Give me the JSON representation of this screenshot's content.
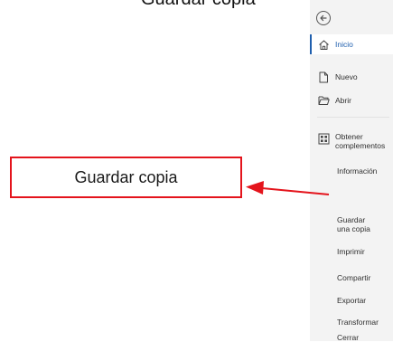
{
  "top_caption": "Guardar copia",
  "callout": {
    "label": "Guardar copia",
    "color": "#e4141c"
  },
  "backstage": {
    "back_icon": "back-arrow-circle-icon",
    "items": [
      {
        "label": "Inicio",
        "icon": "home-icon",
        "selected": true
      },
      {
        "label": "Nuevo",
        "icon": "new-document-icon"
      },
      {
        "label": "Abrir",
        "icon": "open-folder-icon"
      },
      {
        "label": "Obtener complementos",
        "icon": "addins-grid-icon"
      },
      {
        "label": "Información"
      },
      {
        "label": "Guardar una copia"
      },
      {
        "label": "Imprimir"
      },
      {
        "label": "Compartir"
      },
      {
        "label": "Exportar"
      },
      {
        "label": "Transformar"
      },
      {
        "label": "Cerrar"
      }
    ],
    "accent_color": "#1f5fae",
    "background_color": "#f3f3f3"
  }
}
